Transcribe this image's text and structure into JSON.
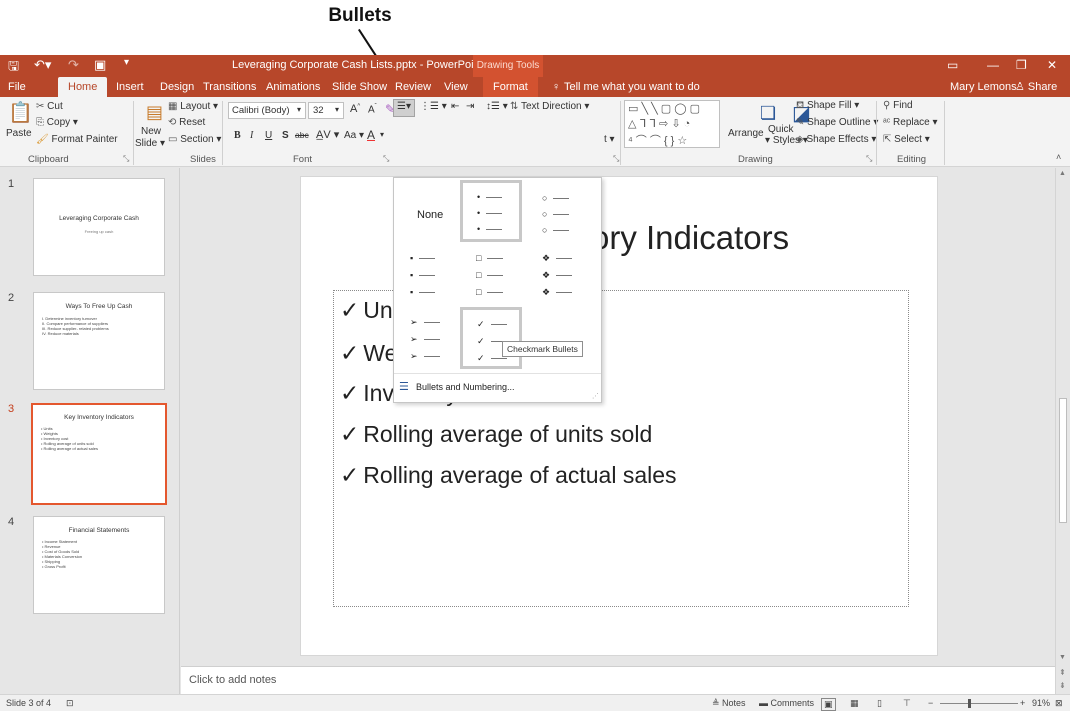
{
  "callout": {
    "label": "Bullets"
  },
  "titlebar": {
    "document_title": "Leveraging Corporate Cash Lists.pptx - PowerPoint",
    "contextual_tab": "Drawing Tools",
    "user_name": "Mary Lemons",
    "share": "Share"
  },
  "tabs": [
    "File",
    "Home",
    "Insert",
    "Design",
    "Transitions",
    "Animations",
    "Slide Show",
    "Review",
    "View",
    "Format"
  ],
  "tell_me": "Tell me what you want to do",
  "ribbon": {
    "clipboard": {
      "paste": "Paste",
      "cut": "Cut",
      "copy": "Copy",
      "format_painter": "Format Painter",
      "label": "Clipboard"
    },
    "slides": {
      "new_slide": "New",
      "new_slide2": "Slide",
      "layout": "Layout",
      "reset": "Reset",
      "section": "Section",
      "label": "Slides"
    },
    "font": {
      "name": "Calibri (Body)",
      "size": "32",
      "bold": "B",
      "italic": "I",
      "underline": "U",
      "shadow": "S",
      "strike": "abc",
      "case": "Aa",
      "label": "Font"
    },
    "paragraph": {
      "text_direction": "Text Direction",
      "label": ""
    },
    "drawing": {
      "arrange": "Arrange",
      "quick": "Quick",
      "styles": "Styles",
      "shape_fill": "Shape Fill",
      "shape_outline": "Shape Outline",
      "shape_effects": "Shape Effects",
      "label": "Drawing"
    },
    "editing": {
      "find": "Find",
      "replace": "Replace",
      "select": "Select",
      "label": "Editing"
    }
  },
  "thumbnails": [
    {
      "num": "1",
      "title": "Leveraging Corporate Cash",
      "subtitle": "Freeing up cash",
      "lines": []
    },
    {
      "num": "2",
      "title": "Ways To Free Up Cash",
      "subtitle": "",
      "lines": [
        "I.   Determine inventory turnover",
        "II.  Compare performance of suppliers",
        "III. Reduce supplier- related problems",
        "IV. Reduce materials"
      ]
    },
    {
      "num": "3",
      "title": "Key Inventory Indicators",
      "subtitle": "",
      "lines": [
        "• Units",
        "• Weights",
        "• Inventory cost",
        "• Rolling average of units sold",
        "• Rolling average of actual sales"
      ]
    },
    {
      "num": "4",
      "title": "Financial Statements",
      "subtitle": "",
      "lines": [
        "• Income Statement",
        "• Revenue",
        "• Cost of Goods Sold",
        "• Materials Conversion",
        "• Shipping",
        "• Gross Profit"
      ]
    }
  ],
  "slide": {
    "title_visible": "ory Indicators",
    "bullets": [
      "Un",
      "Weights",
      "Inventory cost",
      "Rolling average of units sold",
      "Rolling average of actual sales"
    ],
    "bullet_glyph": "✓"
  },
  "dropdown": {
    "none": "None",
    "tooltip": "Checkmark Bullets",
    "footer": "Bullets and Numbering..."
  },
  "notes": {
    "placeholder": "Click to add notes"
  },
  "status": {
    "slide_indicator": "Slide 3 of 4",
    "notes": "Notes",
    "comments": "Comments",
    "zoom": "91%"
  },
  "colors": {
    "accent": "#b7472a",
    "format_tab": "#d35230",
    "selected_thumb": "#e4572e"
  }
}
